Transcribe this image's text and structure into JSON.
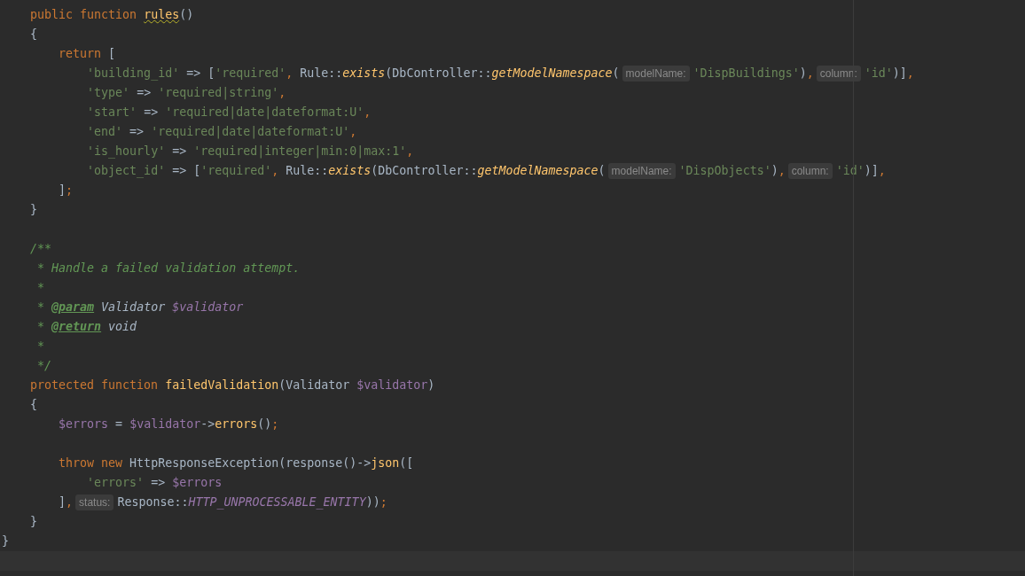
{
  "editor": {
    "blocks": [
      {
        "lines": [
          {
            "tokens": [
              {
                "kind": "kw",
                "t": "    public function "
              },
              {
                "kind": "fn",
                "t": "rules",
                "warning": true
              },
              {
                "kind": "plain",
                "t": "()"
              }
            ]
          },
          {
            "tokens": [
              {
                "kind": "plain",
                "t": "    {"
              }
            ]
          },
          {
            "tokens": [
              {
                "kind": "kw",
                "t": "        return "
              },
              {
                "kind": "plain",
                "t": "["
              }
            ]
          },
          {
            "tokens": [
              {
                "kind": "str",
                "t": "            'building_id'"
              },
              {
                "kind": "plain",
                "t": " => ["
              },
              {
                "kind": "str",
                "t": "'required'"
              },
              {
                "kind": "kw",
                "t": ", "
              },
              {
                "kind": "plain",
                "t": "Rule::"
              },
              {
                "kind": "fni",
                "t": "exists"
              },
              {
                "kind": "plain",
                "t": "(DbController::"
              },
              {
                "kind": "fni",
                "t": "getModelNamespace"
              },
              {
                "kind": "plain",
                "t": "("
              },
              {
                "kind": "hint",
                "t": "modelName:"
              },
              {
                "kind": "str",
                "t": "'DispBuildings'"
              },
              {
                "kind": "plain",
                "t": ")"
              },
              {
                "kind": "kw",
                "t": ","
              },
              {
                "kind": "hint",
                "t": "column:"
              },
              {
                "kind": "str",
                "t": "'id'"
              },
              {
                "kind": "plain",
                "t": ")]"
              },
              {
                "kind": "kw",
                "t": ","
              }
            ]
          },
          {
            "tokens": [
              {
                "kind": "str",
                "t": "            'type'"
              },
              {
                "kind": "plain",
                "t": " => "
              },
              {
                "kind": "str",
                "t": "'required|string'"
              },
              {
                "kind": "kw",
                "t": ","
              }
            ]
          },
          {
            "tokens": [
              {
                "kind": "str",
                "t": "            'start'"
              },
              {
                "kind": "plain",
                "t": " => "
              },
              {
                "kind": "str",
                "t": "'required|date|dateformat:U'"
              },
              {
                "kind": "kw",
                "t": ","
              }
            ]
          },
          {
            "tokens": [
              {
                "kind": "str",
                "t": "            'end'"
              },
              {
                "kind": "plain",
                "t": " => "
              },
              {
                "kind": "str",
                "t": "'required|date|dateformat:U'"
              },
              {
                "kind": "kw",
                "t": ","
              }
            ]
          },
          {
            "tokens": [
              {
                "kind": "str",
                "t": "            'is_hourly'"
              },
              {
                "kind": "plain",
                "t": " => "
              },
              {
                "kind": "str",
                "t": "'required|integer|min:0|max:1'"
              },
              {
                "kind": "kw",
                "t": ","
              }
            ]
          },
          {
            "tokens": [
              {
                "kind": "str",
                "t": "            'object_id'"
              },
              {
                "kind": "plain",
                "t": " => ["
              },
              {
                "kind": "str",
                "t": "'required'"
              },
              {
                "kind": "kw",
                "t": ", "
              },
              {
                "kind": "plain",
                "t": "Rule::"
              },
              {
                "kind": "fni",
                "t": "exists"
              },
              {
                "kind": "plain",
                "t": "(DbController::"
              },
              {
                "kind": "fni",
                "t": "getModelNamespace"
              },
              {
                "kind": "plain",
                "t": "("
              },
              {
                "kind": "hint",
                "t": "modelName:"
              },
              {
                "kind": "str",
                "t": "'DispObjects'"
              },
              {
                "kind": "plain",
                "t": ")"
              },
              {
                "kind": "kw",
                "t": ","
              },
              {
                "kind": "hint",
                "t": "column:"
              },
              {
                "kind": "str",
                "t": "'id'"
              },
              {
                "kind": "plain",
                "t": ")]"
              },
              {
                "kind": "kw",
                "t": ","
              }
            ]
          },
          {
            "tokens": [
              {
                "kind": "plain",
                "t": "        ]"
              },
              {
                "kind": "kw",
                "t": ";"
              }
            ]
          },
          {
            "tokens": [
              {
                "kind": "plain",
                "t": "    }"
              }
            ]
          }
        ]
      },
      {
        "lines": [
          {
            "tokens": [
              {
                "kind": "comment",
                "t": "    /**"
              }
            ]
          },
          {
            "tokens": [
              {
                "kind": "comment",
                "t": "     * Handle a failed validation attempt."
              }
            ]
          },
          {
            "tokens": [
              {
                "kind": "comment",
                "t": "     *"
              }
            ]
          },
          {
            "tokens": [
              {
                "kind": "comment",
                "t": "     * "
              },
              {
                "kind": "tag",
                "t": "@param"
              },
              {
                "kind": "ital",
                "t": " Validator "
              },
              {
                "kind": "vari",
                "t": "$validator"
              }
            ]
          },
          {
            "tokens": [
              {
                "kind": "comment",
                "t": "     * "
              },
              {
                "kind": "tag",
                "t": "@return"
              },
              {
                "kind": "ital",
                "t": " void"
              }
            ]
          },
          {
            "tokens": [
              {
                "kind": "comment",
                "t": "     *"
              }
            ]
          },
          {
            "tokens": [
              {
                "kind": "comment",
                "t": "     */"
              }
            ]
          },
          {
            "tokens": [
              {
                "kind": "kw",
                "t": "    protected function "
              },
              {
                "kind": "fn",
                "t": "failedValidation"
              },
              {
                "kind": "plain",
                "t": "(Validator "
              },
              {
                "kind": "var",
                "t": "$validator"
              },
              {
                "kind": "plain",
                "t": ")"
              }
            ]
          },
          {
            "tokens": [
              {
                "kind": "plain",
                "t": "    {"
              }
            ]
          },
          {
            "tokens": [
              {
                "kind": "var",
                "t": "        $errors"
              },
              {
                "kind": "plain",
                "t": " = "
              },
              {
                "kind": "var",
                "t": "$validator"
              },
              {
                "kind": "plain",
                "t": "->"
              },
              {
                "kind": "fn",
                "t": "errors"
              },
              {
                "kind": "plain",
                "t": "()"
              },
              {
                "kind": "kw",
                "t": ";"
              }
            ]
          }
        ]
      },
      {
        "lines": [
          {
            "tokens": [
              {
                "kind": "kw",
                "t": "        throw new "
              },
              {
                "kind": "plain",
                "t": "HttpResponseException(response()->"
              },
              {
                "kind": "fn",
                "t": "json"
              },
              {
                "kind": "plain",
                "t": "(["
              }
            ]
          },
          {
            "tokens": [
              {
                "kind": "str",
                "t": "            'errors'"
              },
              {
                "kind": "plain",
                "t": " => "
              },
              {
                "kind": "var",
                "t": "$errors"
              }
            ]
          },
          {
            "tokens": [
              {
                "kind": "plain",
                "t": "        ]"
              },
              {
                "kind": "kw",
                "t": ","
              },
              {
                "kind": "hint",
                "t": "status:"
              },
              {
                "kind": "plain",
                "t": "Response::"
              },
              {
                "kind": "const",
                "t": "HTTP_UNPROCESSABLE_ENTITY"
              },
              {
                "kind": "plain",
                "t": "))"
              },
              {
                "kind": "kw",
                "t": ";"
              }
            ]
          },
          {
            "tokens": [
              {
                "kind": "plain",
                "t": "    }"
              }
            ]
          },
          {
            "tokens": [
              {
                "kind": "plain",
                "t": "}"
              }
            ]
          }
        ]
      }
    ]
  }
}
